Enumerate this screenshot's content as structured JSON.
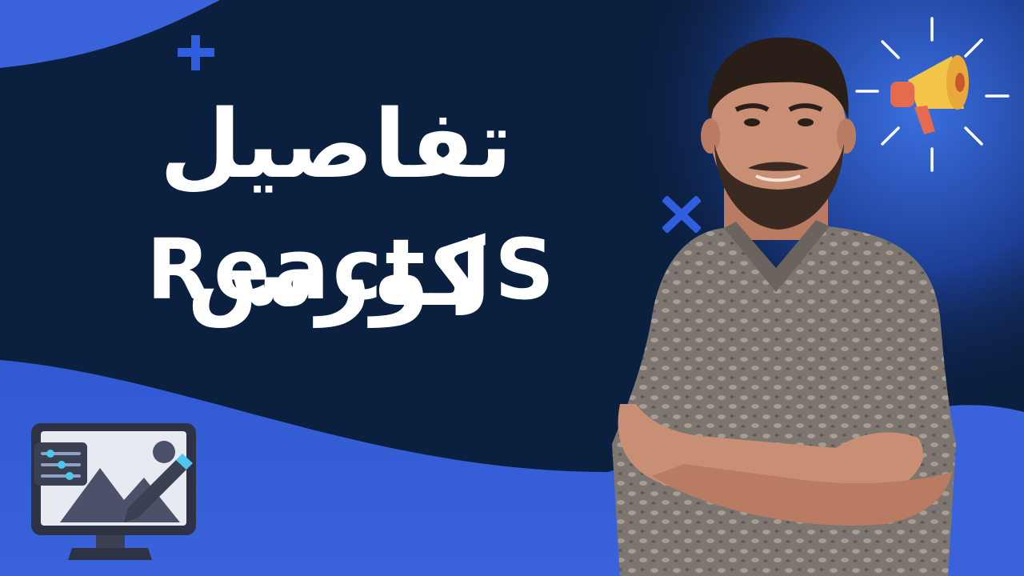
{
  "title": {
    "arabic": "تفاصيل كورس",
    "english": "React JS"
  },
  "colors": {
    "background_dark": "#0b1f3f",
    "accent_blue": "#3a63db",
    "text": "#ffffff",
    "shirt_gray": "#7d756f",
    "skin": "#c98f74",
    "hair": "#2a1e18",
    "megaphone_yellow": "#f3c44a",
    "megaphone_red": "#e56b4f"
  },
  "icons": [
    "plus-icon",
    "x-mark-icon",
    "megaphone-icon",
    "monitor-illustration-icon"
  ]
}
